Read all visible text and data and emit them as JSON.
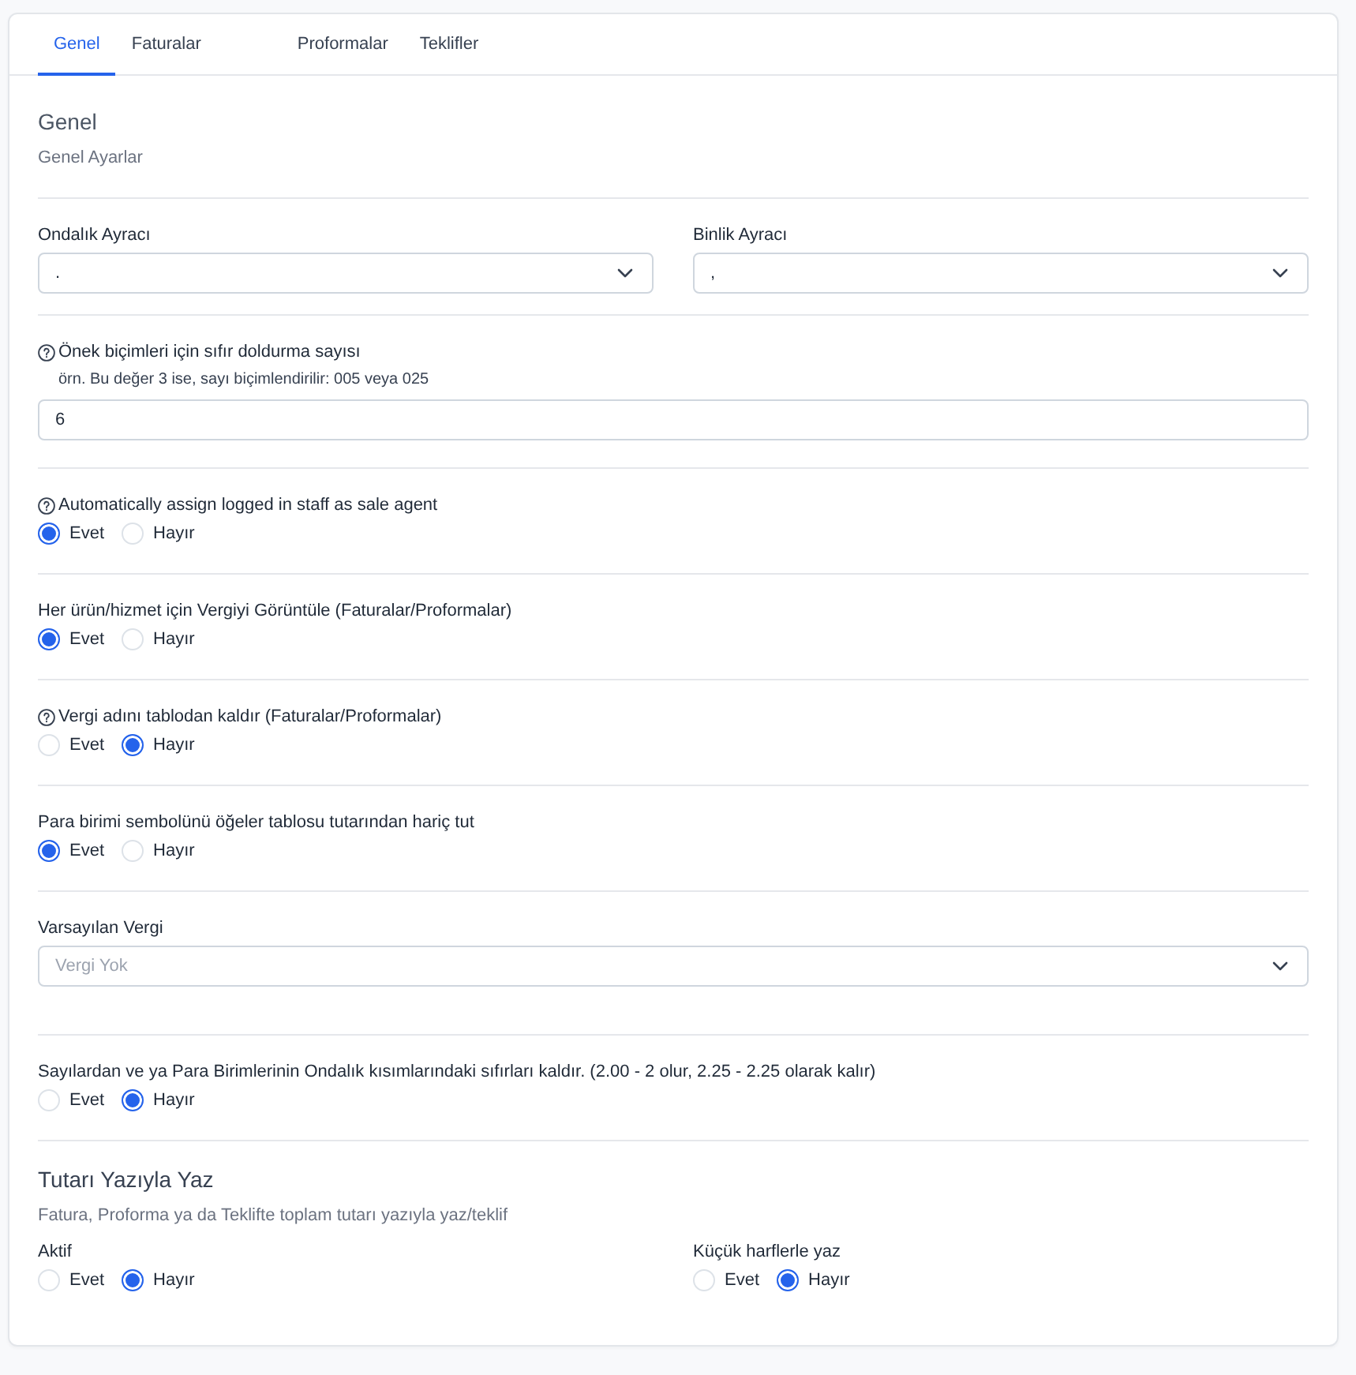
{
  "tabs": [
    {
      "label": "Genel",
      "selected": true
    },
    {
      "label": "Faturalar",
      "selected": false
    },
    {
      "label": "Proformalar",
      "selected": false
    },
    {
      "label": "Teklifler",
      "selected": false
    }
  ],
  "general": {
    "title": "Genel",
    "subtitle": "Genel Ayarlar"
  },
  "fields": [
    {
      "kind": "select_row",
      "selects": [
        {
          "label": "Ondalık Ayracı",
          "value": "."
        },
        {
          "label": "Binlik Ayracı",
          "value": ","
        }
      ]
    },
    {
      "kind": "input",
      "help": true,
      "label": "Önek biçimleri için sıfır doldurma sayısı",
      "hint": "örn. Bu değer 3 ise, sayı biçimlendirilir: 005 veya 025",
      "value": "6"
    },
    {
      "kind": "radio",
      "help": true,
      "label": "Automatically assign logged in staff as sale agent",
      "options": [
        {
          "label": "Evet",
          "selected": true
        },
        {
          "label": "Hayır",
          "selected": false
        }
      ]
    },
    {
      "kind": "radio",
      "help": false,
      "label": "Her ürün/hizmet için Vergiyi Görüntüle (Faturalar/Proformalar)",
      "options": [
        {
          "label": "Evet",
          "selected": true
        },
        {
          "label": "Hayır",
          "selected": false
        }
      ]
    },
    {
      "kind": "radio",
      "help": true,
      "label": "Vergi adını tablodan kaldır (Faturalar/Proformalar)",
      "options": [
        {
          "label": "Evet",
          "selected": false
        },
        {
          "label": "Hayır",
          "selected": true
        }
      ]
    },
    {
      "kind": "radio",
      "help": false,
      "label": "Para birimi sembolünü öğeler tablosu tutarından hariç tut",
      "options": [
        {
          "label": "Evet",
          "selected": true
        },
        {
          "label": "Hayır",
          "selected": false
        }
      ]
    },
    {
      "kind": "select",
      "help": false,
      "label": "Varsayılan Vergi",
      "placeholder": "Vergi Yok"
    },
    {
      "kind": "radio",
      "help": false,
      "label": "Sayılardan ve ya Para Birimlerinin Ondalık kısımlarındaki sıfırları kaldır. (2.00 - 2 olur, 2.25 - 2.25 olarak kalır)",
      "options": [
        {
          "label": "Evet",
          "selected": false
        },
        {
          "label": "Hayır",
          "selected": true
        }
      ]
    }
  ],
  "amount_in_words": {
    "title": "Tutarı Yazıyla Yaz",
    "subtitle": "Fatura, Proforma ya da Teklifte toplam tutarı yazıyla yaz/teklif",
    "groups": [
      {
        "label": "Aktif",
        "options": [
          {
            "label": "Evet",
            "selected": false
          },
          {
            "label": "Hayır",
            "selected": true
          }
        ]
      },
      {
        "label": "Küçük harflerle yaz",
        "options": [
          {
            "label": "Evet",
            "selected": false
          },
          {
            "label": "Hayır",
            "selected": true
          }
        ]
      }
    ]
  }
}
